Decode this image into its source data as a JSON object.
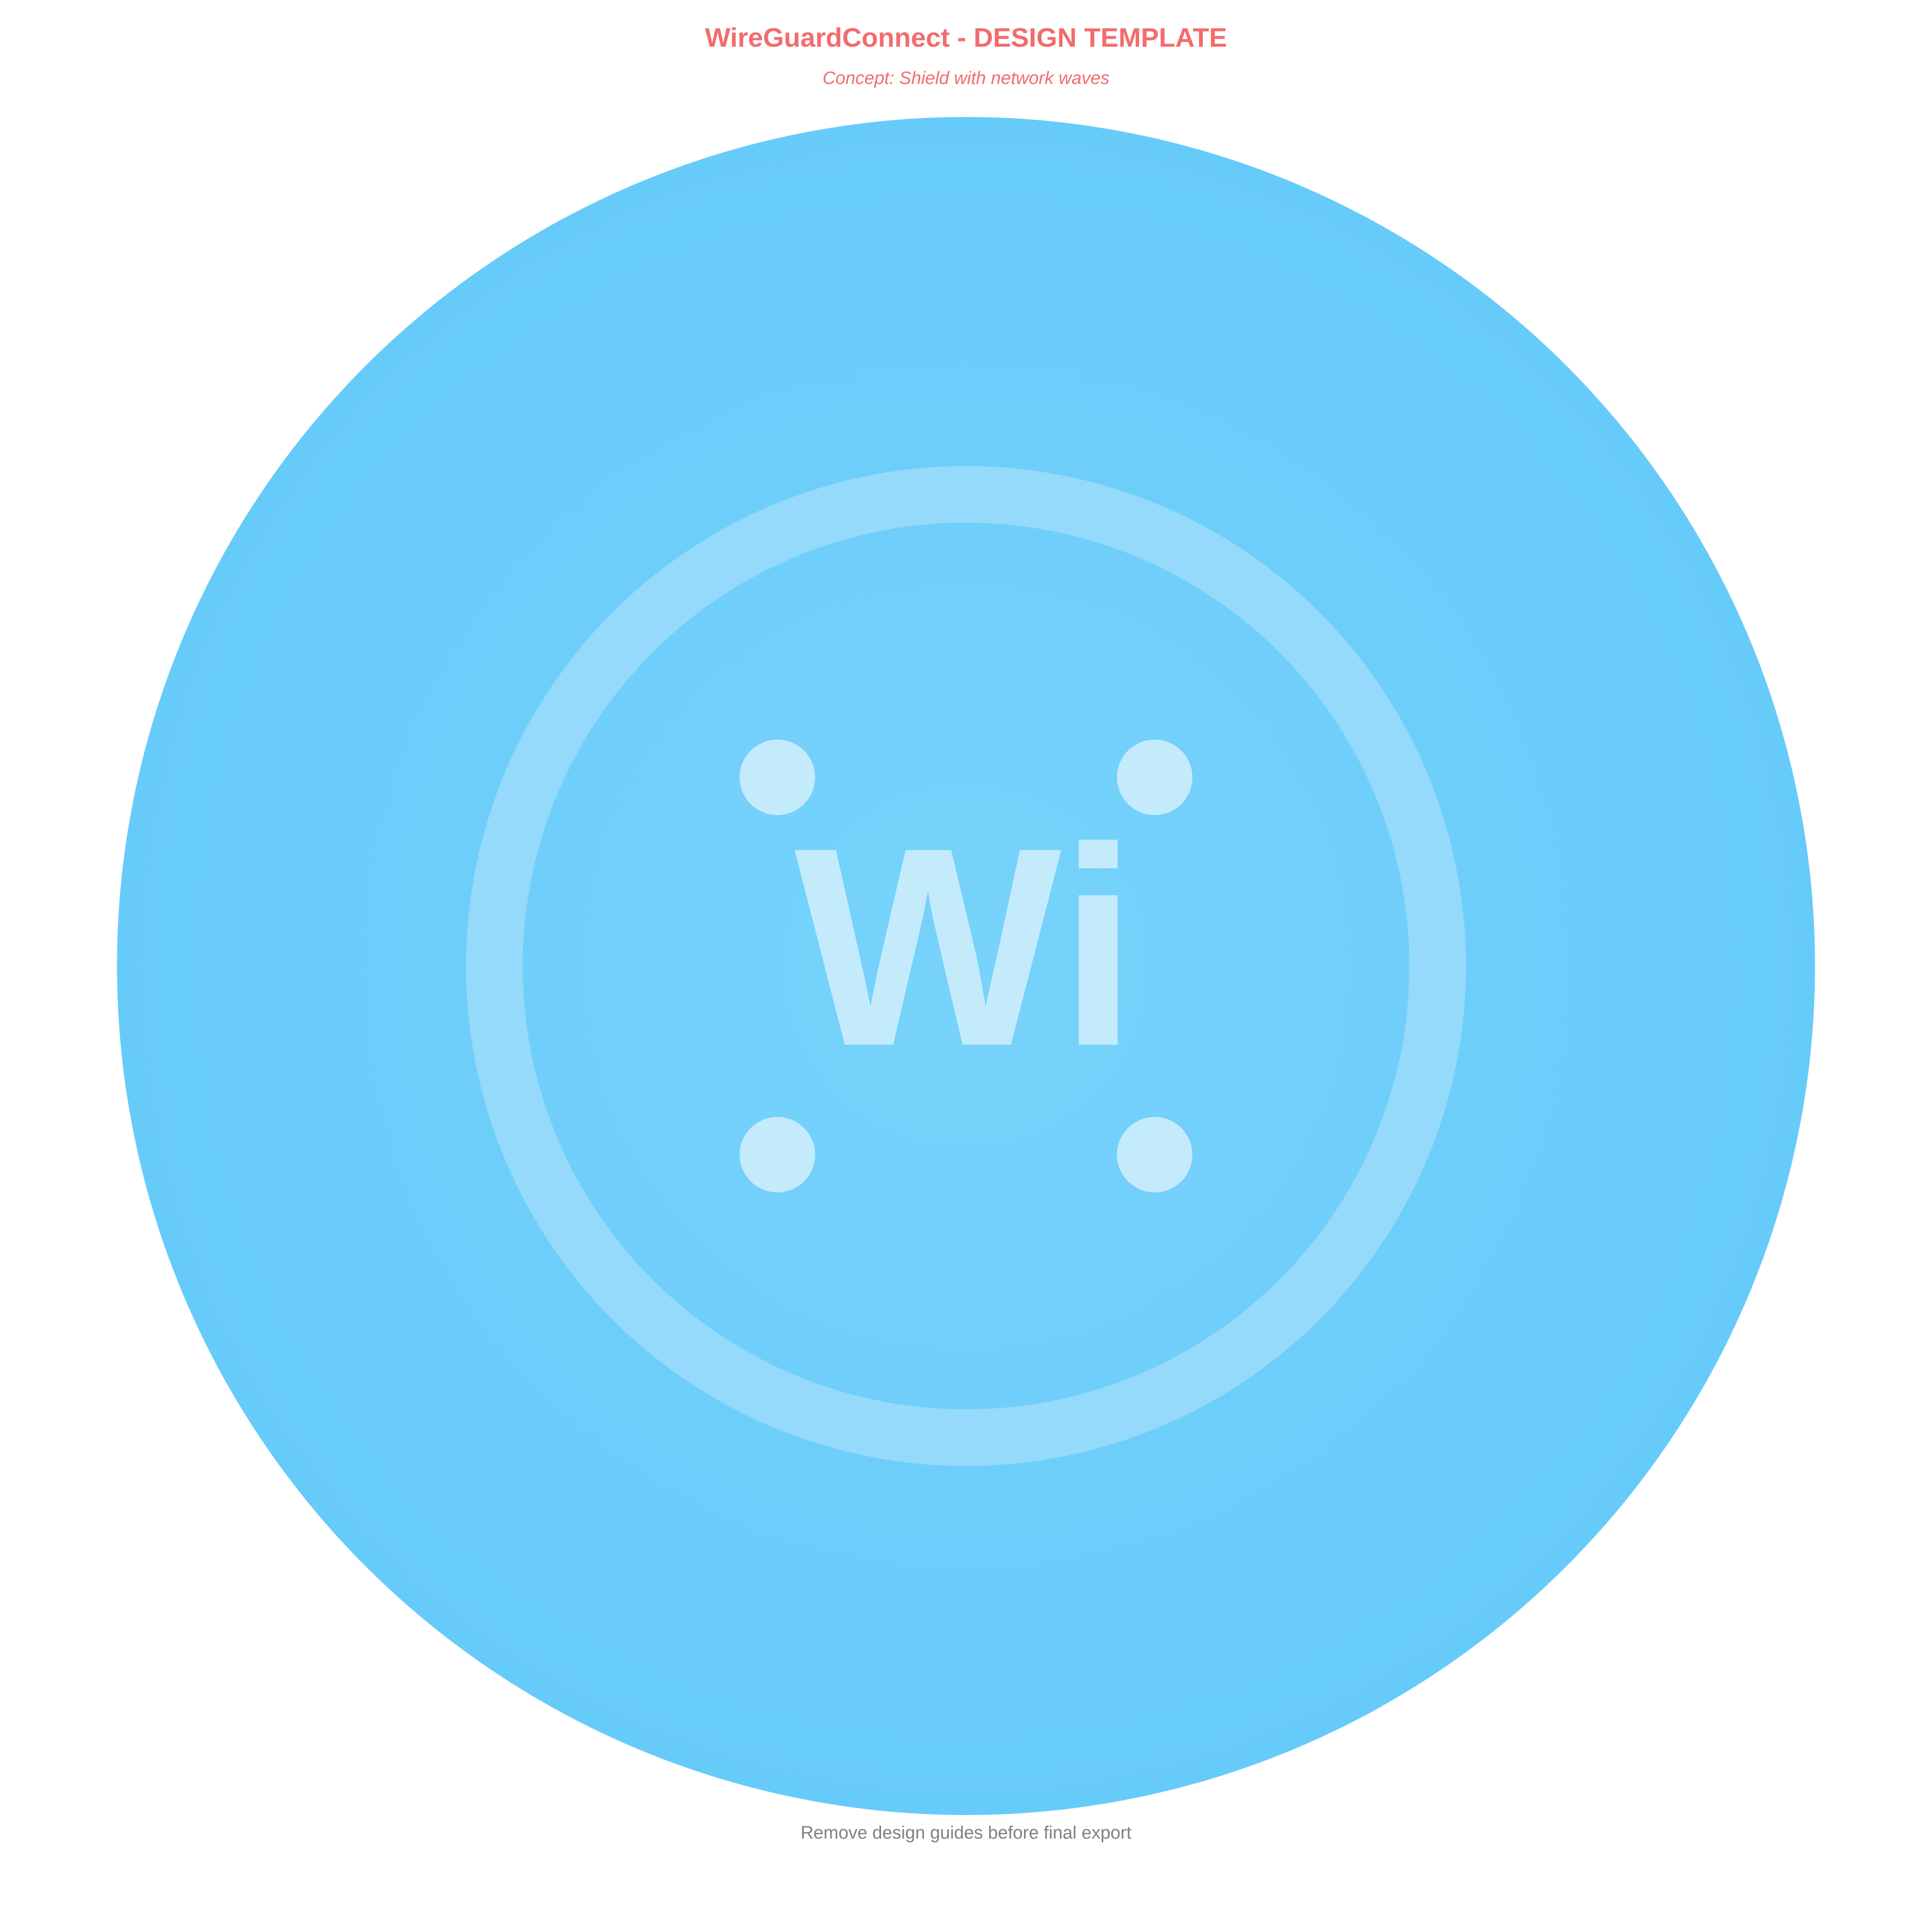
{
  "header": {
    "title": "WireGuardConnect - DESIGN TEMPLATE",
    "subtitle": "Concept: Shield with network waves"
  },
  "logo": {
    "monogram": "Wi",
    "icon_name": "wireguard-connect-logo",
    "colors": {
      "background_center": "#78d3fb",
      "background_edge": "#67cbfa",
      "ring": "#95dafb",
      "glyph": "#c4ebfc"
    }
  },
  "footer": {
    "note": "Remove design guides before final export"
  },
  "colors": {
    "title": "#f26c6e",
    "subtitle": "#f26c6e",
    "footer": "#808080",
    "page_background": "#ffffff"
  }
}
